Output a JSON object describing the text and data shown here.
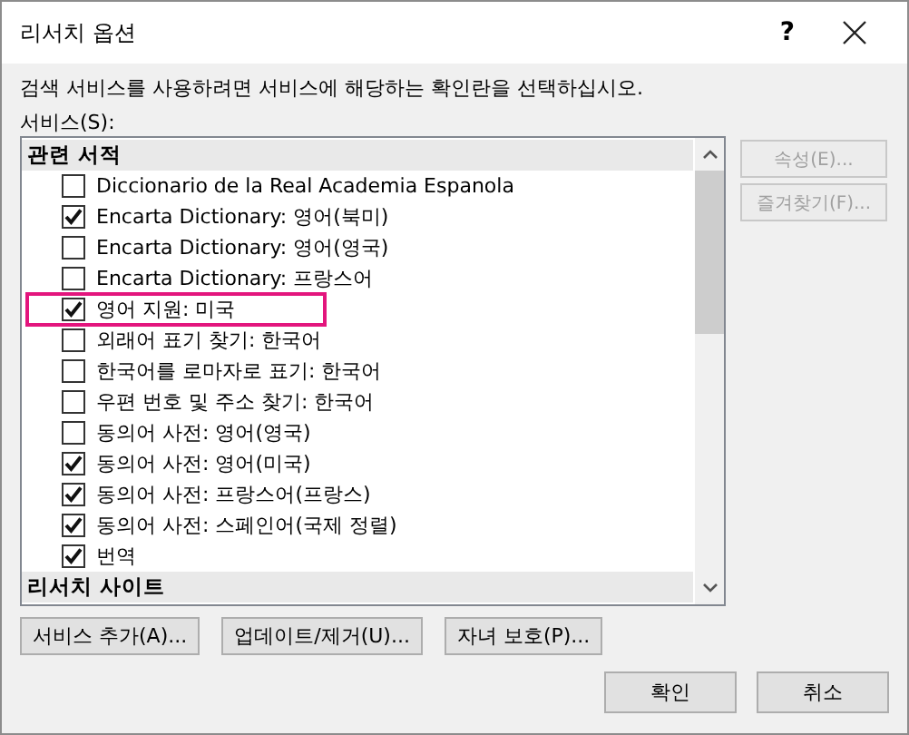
{
  "window": {
    "title": "리서치 옵션",
    "help": "?"
  },
  "instruction": "검색 서비스를 사용하려면 서비스에 해당하는 확인란을 선택하십시오.",
  "services_label": "서비스(S):",
  "services": [
    {
      "kind": "header",
      "label": "관련 서적"
    },
    {
      "kind": "item",
      "label": "Diccionario de la Real Academia Espanola",
      "checked": false,
      "highlighted": false
    },
    {
      "kind": "item",
      "label": "Encarta Dictionary: 영어(북미)",
      "checked": true,
      "highlighted": false
    },
    {
      "kind": "item",
      "label": "Encarta Dictionary: 영어(영국)",
      "checked": false,
      "highlighted": false
    },
    {
      "kind": "item",
      "label": "Encarta Dictionary: 프랑스어",
      "checked": false,
      "highlighted": false
    },
    {
      "kind": "item",
      "label": "영어 지원: 미국",
      "checked": true,
      "highlighted": true
    },
    {
      "kind": "item",
      "label": "외래어 표기 찾기: 한국어",
      "checked": false,
      "highlighted": false
    },
    {
      "kind": "item",
      "label": "한국어를 로마자로 표기: 한국어",
      "checked": false,
      "highlighted": false
    },
    {
      "kind": "item",
      "label": "우편 번호 및 주소 찾기: 한국어",
      "checked": false,
      "highlighted": false
    },
    {
      "kind": "item",
      "label": "동의어 사전: 영어(영국)",
      "checked": false,
      "highlighted": false
    },
    {
      "kind": "item",
      "label": "동의어 사전: 영어(미국)",
      "checked": true,
      "highlighted": false
    },
    {
      "kind": "item",
      "label": "동의어 사전: 프랑스어(프랑스)",
      "checked": true,
      "highlighted": false
    },
    {
      "kind": "item",
      "label": "동의어 사전: 스페인어(국제 정렬)",
      "checked": true,
      "highlighted": false
    },
    {
      "kind": "item",
      "label": "번역",
      "checked": true,
      "highlighted": false
    },
    {
      "kind": "header",
      "label": "리서치 사이트"
    }
  ],
  "side_buttons": [
    {
      "label": "속성(E)...",
      "disabled": true
    },
    {
      "label": "즐겨찾기(F)...",
      "disabled": true
    }
  ],
  "bottom_buttons": [
    {
      "label": "서비스 추가(A)..."
    },
    {
      "label": "업데이트/제거(U)..."
    },
    {
      "label": "자녀 보호(P)..."
    }
  ],
  "dialog_buttons": [
    {
      "label": "확인"
    },
    {
      "label": "취소"
    }
  ]
}
